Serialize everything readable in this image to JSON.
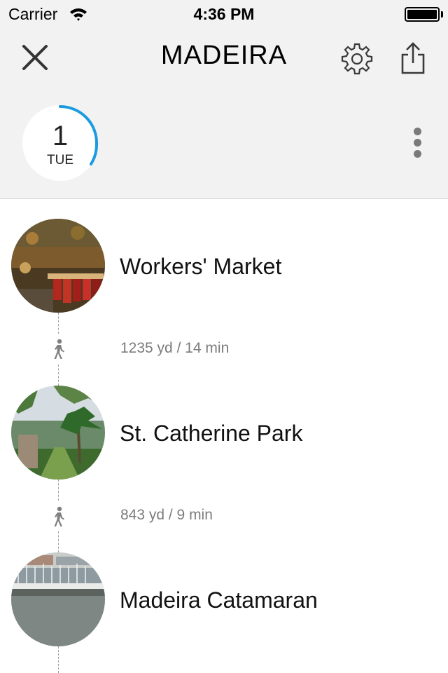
{
  "status_bar": {
    "carrier": "Carrier",
    "time": "4:36 PM"
  },
  "nav": {
    "title": "MADEIRA",
    "close_icon": "close-icon",
    "settings_icon": "gear-icon",
    "share_icon": "share-icon"
  },
  "day": {
    "number": "1",
    "weekday": "TUE",
    "ring_color": "#1c9be0"
  },
  "itinerary": {
    "places": [
      {
        "name": "Workers' Market",
        "thumb": "market-photo"
      },
      {
        "name": "St. Catherine Park",
        "thumb": "park-photo"
      },
      {
        "name": "Madeira Catamaran",
        "thumb": "harbor-photo"
      }
    ],
    "legs": [
      {
        "mode": "walk-icon",
        "text": "1235 yd / 14 min"
      },
      {
        "mode": "walk-icon",
        "text": "843 yd / 9 min"
      }
    ]
  }
}
